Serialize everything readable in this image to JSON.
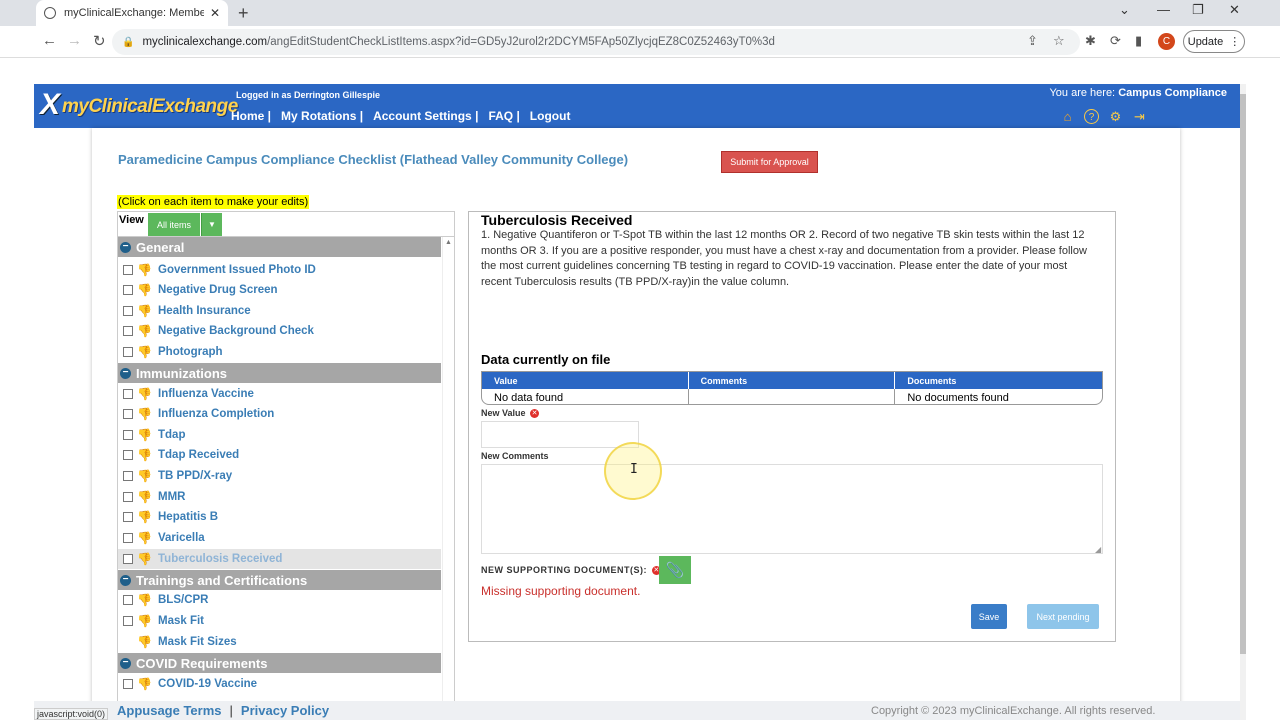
{
  "browser": {
    "tab_title": "myClinicalExchange: Member Co",
    "url_host": "myclinicalexchange.com",
    "url_path": "/angEditStudentCheckListItems.aspx?id=GD5yJ2urol2r2DCYM5FAp50ZlycjqEZ8C0Z52463yT0%3d",
    "update_label": "Update",
    "profile_initial": "C",
    "status_url": "javascript:void(0)"
  },
  "header": {
    "logo_x": "X",
    "logo_text": "myClinicalExchange",
    "logged_in": "Logged in as Derrington Gillespie",
    "nav": [
      "Home |",
      "My Rotations |",
      "Account Settings |",
      "FAQ |",
      "Logout"
    ],
    "here_label": "You are here:",
    "here_page": "Campus Compliance",
    "icons": [
      "home-icon",
      "help-icon",
      "settings-icon",
      "export-icon"
    ]
  },
  "page": {
    "title": "Paramedicine Campus Compliance Checklist (Flathead Valley Community College)",
    "submit_label": "Submit for Approval",
    "hint": "(Click on each item to make your edits)",
    "view_label": "View",
    "view_filter": "All items"
  },
  "checklist": {
    "sections": [
      {
        "title": "General",
        "items": [
          "Government Issued Photo ID",
          "Negative Drug Screen",
          "Health Insurance",
          "Negative Background Check",
          "Photograph"
        ]
      },
      {
        "title": "Immunizations",
        "items": [
          "Influenza Vaccine",
          "Influenza Completion",
          "Tdap",
          "Tdap Received",
          "TB PPD/X-ray",
          "MMR",
          "Hepatitis B",
          "Varicella",
          "Tuberculosis Received"
        ]
      },
      {
        "title": "Trainings and Certifications",
        "items": [
          "BLS/CPR",
          "Mask Fit",
          "Mask Fit Sizes"
        ]
      },
      {
        "title": "COVID Requirements",
        "items": [
          "COVID-19 Vaccine"
        ]
      }
    ]
  },
  "detail": {
    "title": "Tuberculosis Received",
    "description": "1. Negative Quantiferon or T-Spot TB within the last 12 months OR 2. Record of two negative TB skin tests within the last 12 months OR 3. If you are a positive responder, you must have a chest x-ray and documentation from a provider. Please follow the most current guidelines concerning TB testing in regard to COVID-19 vaccination. Please enter the date of your most recent Tuberculosis results (TB PPD/X-ray)in the value column.",
    "data_heading": "Data currently on file",
    "table": {
      "headers": [
        "Value",
        "Comments",
        "Documents"
      ],
      "row": [
        "No data found",
        "",
        "No documents found"
      ]
    },
    "new_value_label": "New Value",
    "new_comments_label": "New Comments",
    "supporting_label": "NEW SUPPORTING DOCUMENT(S):",
    "missing": "Missing supporting document.",
    "save_label": "Save",
    "next_label": "Next pending"
  },
  "footer": {
    "terms": "Appusage Terms",
    "privacy": "Privacy Policy",
    "copyright": "Copyright © 2023 myClinicalExchange. All rights reserved."
  },
  "colors": {
    "header_blue": "#2b67c4",
    "accent_green": "#5cb85c",
    "alert_red": "#d9534f",
    "link_blue": "#3a7db5"
  }
}
